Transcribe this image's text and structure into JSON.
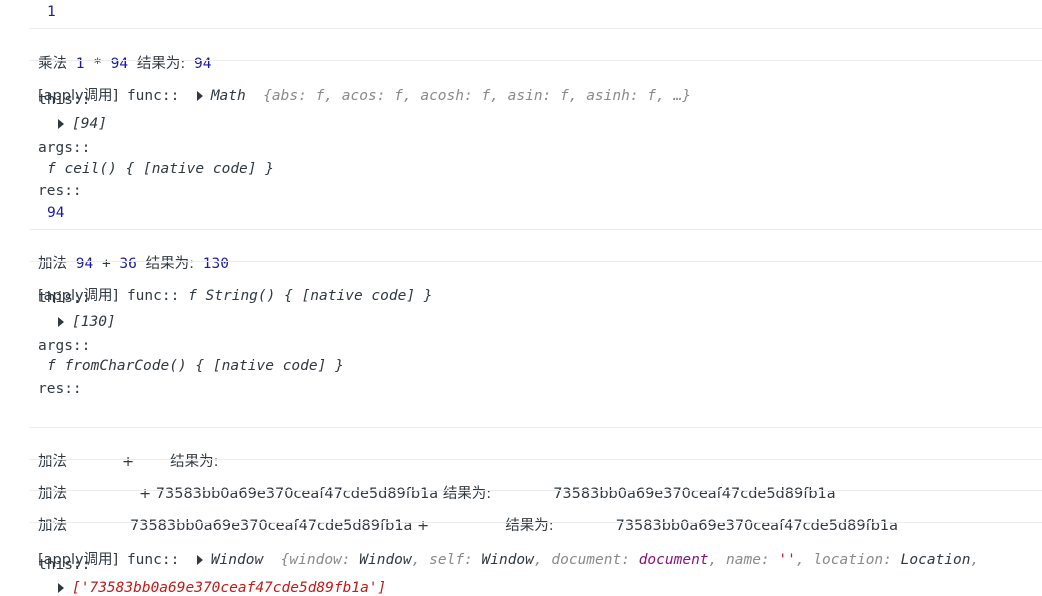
{
  "console": {
    "line1_value": "1",
    "mul": {
      "label": "乘法",
      "expr_a": "1",
      "op": "*",
      "expr_b": "94",
      "result_label": "结果为:",
      "result": "94"
    },
    "apply1": {
      "prefix": "[apply调用]",
      "func_label": "func::",
      "obj_name": "Math",
      "obj_preview": "{abs: f, acos: f, acosh: f, asin: f, asinh: f, …}",
      "this_label": "this::",
      "this_value": "[94]",
      "args_label": "args::",
      "args_value": "f ceil() { [native code] }",
      "res_label": "res::",
      "res_value": "94"
    },
    "add1": {
      "label": "加法",
      "expr_a": "94",
      "op": "+",
      "expr_b": "36",
      "result_label": "结果为:",
      "result": "130"
    },
    "apply2": {
      "prefix": "[apply调用]",
      "func_label": "func::",
      "func_value": "f String() { [native code] }",
      "this_label": "this::",
      "this_value": "[130]",
      "args_label": "args::",
      "args_value": "f fromCharCode() { [native code] }",
      "res_label": "res::",
      "res_value": ""
    },
    "add2": {
      "label": "加法",
      "op": "+",
      "result_label": "结果为:"
    },
    "add3": {
      "label": "加法",
      "op": "+",
      "value": "73583bb0a69e370ceaf47cde5d89fb1a",
      "result_label": "结果为:",
      "result": "73583bb0a69e370ceaf47cde5d89fb1a"
    },
    "add4": {
      "label": "加法",
      "value": "73583bb0a69e370ceaf47cde5d89fb1a",
      "op": "+",
      "result_label": "结果为:",
      "result": "73583bb0a69e370ceaf47cde5d89fb1a"
    },
    "apply3": {
      "prefix": "[apply调用]",
      "func_label": "func::",
      "obj_name": "Window",
      "preview": [
        {
          "k": "window",
          "v": "Window"
        },
        {
          "k": "self",
          "v": "Window"
        },
        {
          "k": "document",
          "v": "document"
        },
        {
          "k": "name",
          "v": "''"
        },
        {
          "k": "location",
          "v": "Location"
        }
      ],
      "this_label": "this::",
      "this_value": "['73583bb0a69e370ceaf47cde5d89fb1a']"
    }
  }
}
